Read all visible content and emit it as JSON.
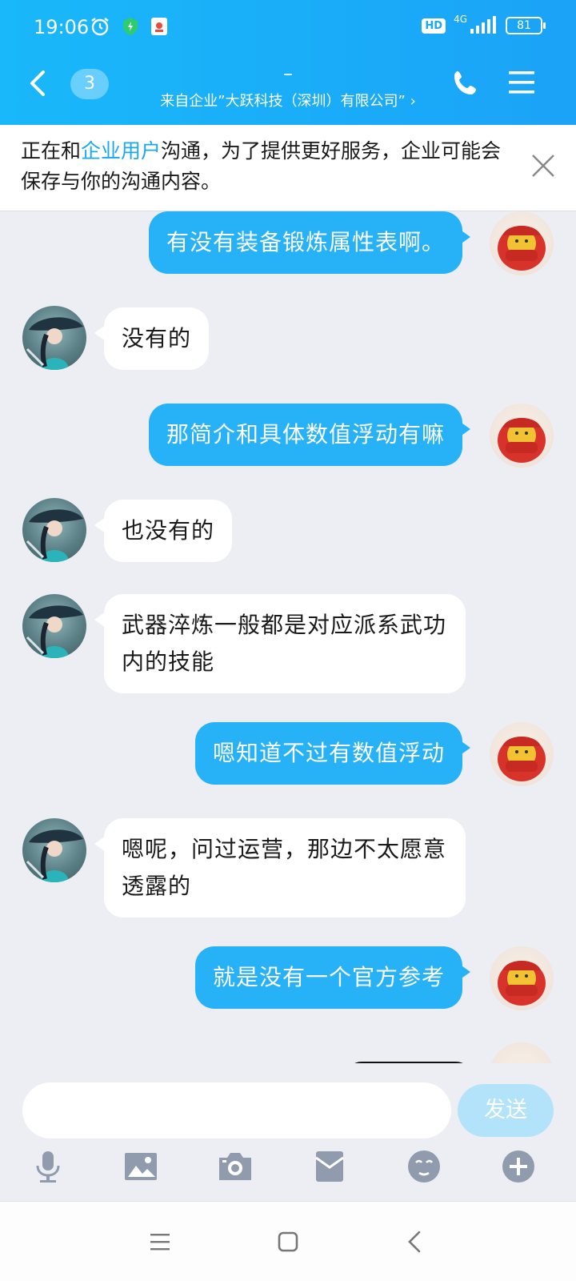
{
  "status_bar": {
    "time": "19:06",
    "hd": "HD",
    "network": "4G",
    "battery": "81"
  },
  "header": {
    "unread_count": "3",
    "title": "–",
    "subtitle": "来自企业”大跃科技（深圳）有限公司” ›"
  },
  "notice": {
    "prefix": "正在和",
    "highlight": "企业用户",
    "suffix": "沟通，为了提供更好服务，企业可能会保存与你的沟通内容。"
  },
  "messages": [
    {
      "from": "me",
      "text": "有没有装备锻炼属性表啊。"
    },
    {
      "from": "them",
      "text": "没有的"
    },
    {
      "from": "me",
      "text": "那简介和具体数值浮动有嘛"
    },
    {
      "from": "them",
      "text": "也没有的"
    },
    {
      "from": "them",
      "text": "武器淬炼一般都是对应派系武功内的技能"
    },
    {
      "from": "me",
      "text": "嗯知道不过有数值浮动"
    },
    {
      "from": "them",
      "text": "嗯呢，问过运营，那边不太愿意透露的"
    },
    {
      "from": "me",
      "text": "就是没有一个官方参考"
    }
  ],
  "composer": {
    "placeholder": "",
    "send_label": "发送"
  },
  "colors": {
    "header_blue": "#1ba8f8",
    "my_bubble": "#27b1f6",
    "their_bubble": "#ffffff",
    "send_disabled": "#b3e3fb"
  },
  "icons": {
    "tools": [
      "microphone-icon",
      "image-icon",
      "camera-icon",
      "red-packet-icon",
      "emoji-icon",
      "plus-icon"
    ],
    "system_nav": [
      "menu-icon",
      "home-icon",
      "back-icon"
    ]
  }
}
